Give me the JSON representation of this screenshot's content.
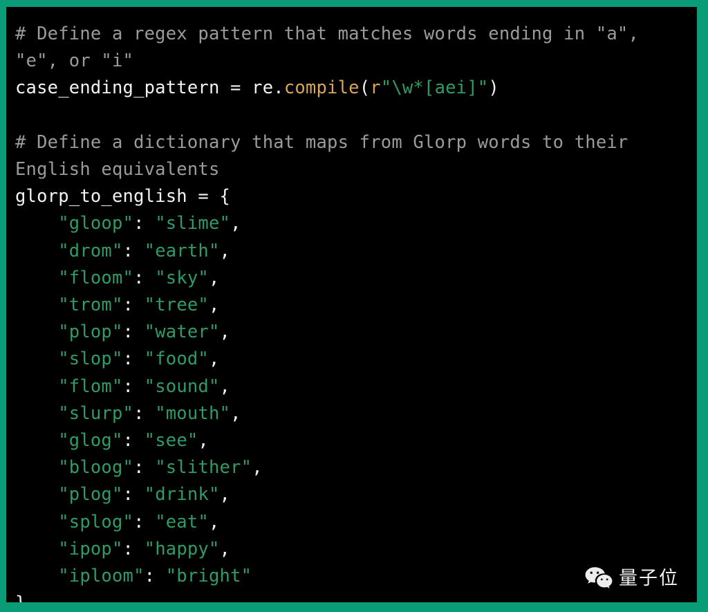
{
  "theme": {
    "border_color": "#0a9b77",
    "background_color": "#000000",
    "comment_color": "#9b9b9b",
    "string_color": "#2f9c66",
    "function_color": "#d8a55c",
    "default_text_color": "#f2f2f2"
  },
  "code": {
    "language": "python",
    "lines": [
      {
        "id": "line-1",
        "kind": "comment",
        "text": "# Define a regex pattern that matches words ending in \"a\", \"e\", or \"i\""
      },
      {
        "id": "line-2",
        "kind": "code",
        "text": "case_ending_pattern = re.compile(r\"\\w*[aei]\")",
        "tokens": {
          "lead": "case_ending_pattern = re.",
          "func": "compile",
          "open_paren": "(",
          "prefix": "r",
          "string": "\"\\w*[aei]\"",
          "close_paren": ")"
        }
      },
      {
        "id": "line-3",
        "kind": "blank",
        "text": ""
      },
      {
        "id": "line-4",
        "kind": "comment",
        "text": "# Define a dictionary that maps from Glorp words to their English equivalents"
      },
      {
        "id": "line-5",
        "kind": "code",
        "text": "glorp_to_english = {",
        "tokens": {
          "lead": "glorp_to_english = {"
        }
      }
    ]
  },
  "dictionary": {
    "variable_name": "glorp_to_english",
    "open_brace": "glorp_to_english = {",
    "close_brace": "}",
    "indent": "    ",
    "entries": [
      {
        "key": "\"gloop\"",
        "sep": ": ",
        "value": "\"slime\"",
        "comma": ","
      },
      {
        "key": "\"drom\"",
        "sep": ": ",
        "value": "\"earth\"",
        "comma": ","
      },
      {
        "key": "\"floom\"",
        "sep": ": ",
        "value": "\"sky\"",
        "comma": ","
      },
      {
        "key": "\"trom\"",
        "sep": ": ",
        "value": "\"tree\"",
        "comma": ","
      },
      {
        "key": "\"plop\"",
        "sep": ": ",
        "value": "\"water\"",
        "comma": ","
      },
      {
        "key": "\"slop\"",
        "sep": ": ",
        "value": "\"food\"",
        "comma": ","
      },
      {
        "key": "\"flom\"",
        "sep": ": ",
        "value": "\"sound\"",
        "comma": ","
      },
      {
        "key": "\"slurp\"",
        "sep": ": ",
        "value": "\"mouth\"",
        "comma": ","
      },
      {
        "key": "\"glog\"",
        "sep": ": ",
        "value": "\"see\"",
        "comma": ","
      },
      {
        "key": "\"bloog\"",
        "sep": ": ",
        "value": "\"slither\"",
        "comma": ","
      },
      {
        "key": "\"plog\"",
        "sep": ": ",
        "value": "\"drink\"",
        "comma": ","
      },
      {
        "key": "\"splog\"",
        "sep": ": ",
        "value": "\"eat\"",
        "comma": ","
      },
      {
        "key": "\"ipop\"",
        "sep": ": ",
        "value": "\"happy\"",
        "comma": ","
      },
      {
        "key": "\"iploom\"",
        "sep": ": ",
        "value": "\"bright\"",
        "comma": ""
      }
    ]
  },
  "watermark": {
    "icon": "wechat-icon",
    "text": "量子位"
  }
}
